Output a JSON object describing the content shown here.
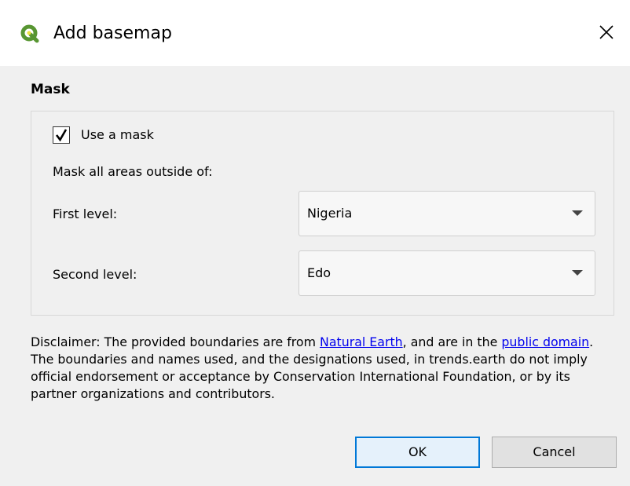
{
  "window": {
    "title": "Add basemap",
    "icon": "qgis-logo-icon",
    "close_icon": "close-icon"
  },
  "mask": {
    "section_title": "Mask",
    "use_mask_label": "Use a mask",
    "use_mask_checked": true,
    "outside_label": "Mask all areas outside of:",
    "first_level_label": "First level:",
    "first_level_value": "Nigeria",
    "second_level_label": "Second level:",
    "second_level_value": "Edo"
  },
  "disclaimer": {
    "prefix": "Disclaimer: The provided boundaries are from ",
    "link1": "Natural Earth",
    "middle": ", and are in the ",
    "link2": "public domain",
    "suffix": ". The boundaries and names used, and the designations used, in trends.earth do not imply official endorsement or acceptance by Conservation International Foundation, or by its partner organizations and contributors."
  },
  "buttons": {
    "ok": "OK",
    "cancel": "Cancel"
  },
  "colors": {
    "accent": "#0078d7",
    "link": "#0000ee",
    "qgis_green": "#589632",
    "qgis_yellow": "#f0e442"
  }
}
